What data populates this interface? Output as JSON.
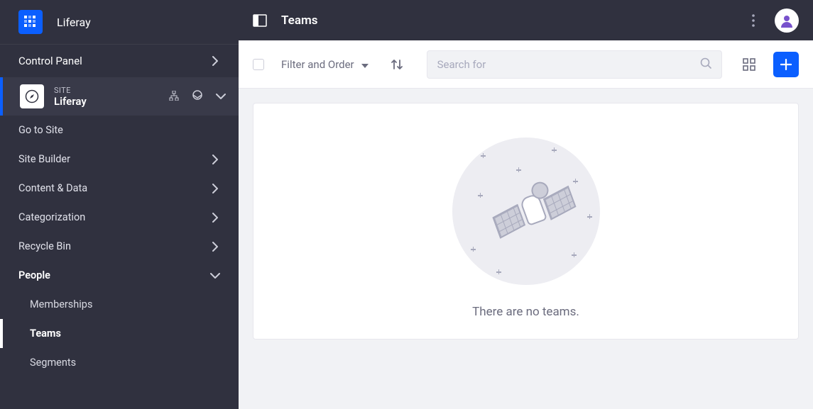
{
  "brand": {
    "name": "Liferay"
  },
  "sidebar": {
    "control_panel": "Control Panel",
    "site_label": "SITE",
    "site_name": "Liferay",
    "go_to_site": "Go to Site",
    "site_builder": "Site Builder",
    "content_data": "Content & Data",
    "categorization": "Categorization",
    "recycle_bin": "Recycle Bin",
    "people": "People",
    "memberships": "Memberships",
    "teams": "Teams",
    "segments": "Segments"
  },
  "header": {
    "title": "Teams"
  },
  "toolbar": {
    "filter_label": "Filter and Order",
    "search_placeholder": "Search for"
  },
  "empty": {
    "message": "There are no teams."
  }
}
